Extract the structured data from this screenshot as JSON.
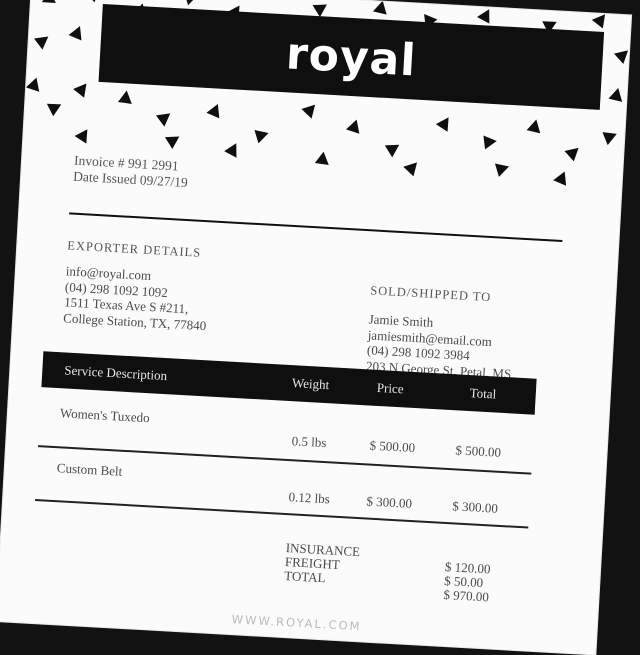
{
  "brand": {
    "name": "royal"
  },
  "invoice": {
    "number_line": "Invoice # 991 2991",
    "date_line": "Date Issued 09/27/19"
  },
  "exporter": {
    "title": "EXPORTER DETAILS",
    "lines": [
      "info@royal.com",
      "(04) 298 1092 1092",
      "1511 Texas Ave S #211,",
      "College Station, TX, 77840"
    ]
  },
  "buyer": {
    "title": "SOLD/SHIPPED TO",
    "lines": [
      "Jamie Smith",
      "jamiesmith@email.com",
      "(04) 298 1092 3984",
      "203 N George St, Petal, MS"
    ]
  },
  "table": {
    "headers": {
      "description": "Service Description",
      "weight": "Weight",
      "price": "Price",
      "total": "Total"
    },
    "rows": [
      {
        "description": "Women's Tuxedo",
        "weight": "0.5 lbs",
        "price": "$ 500.00",
        "total": "$ 500.00"
      },
      {
        "description": "Custom Belt",
        "weight": "0.12 lbs",
        "price": "$ 300.00",
        "total": "$ 300.00"
      }
    ]
  },
  "summary": {
    "labels": [
      "INSURANCE",
      "FREIGHT",
      "TOTAL"
    ],
    "values": [
      "$ 120.00",
      "$ 50.00",
      "$ 970.00"
    ]
  },
  "footer": {
    "website": "WWW.ROYAL.COM"
  },
  "colors": {
    "ink": "#0f0f0f",
    "paper": "#fbfbfb",
    "background": "#121212"
  }
}
